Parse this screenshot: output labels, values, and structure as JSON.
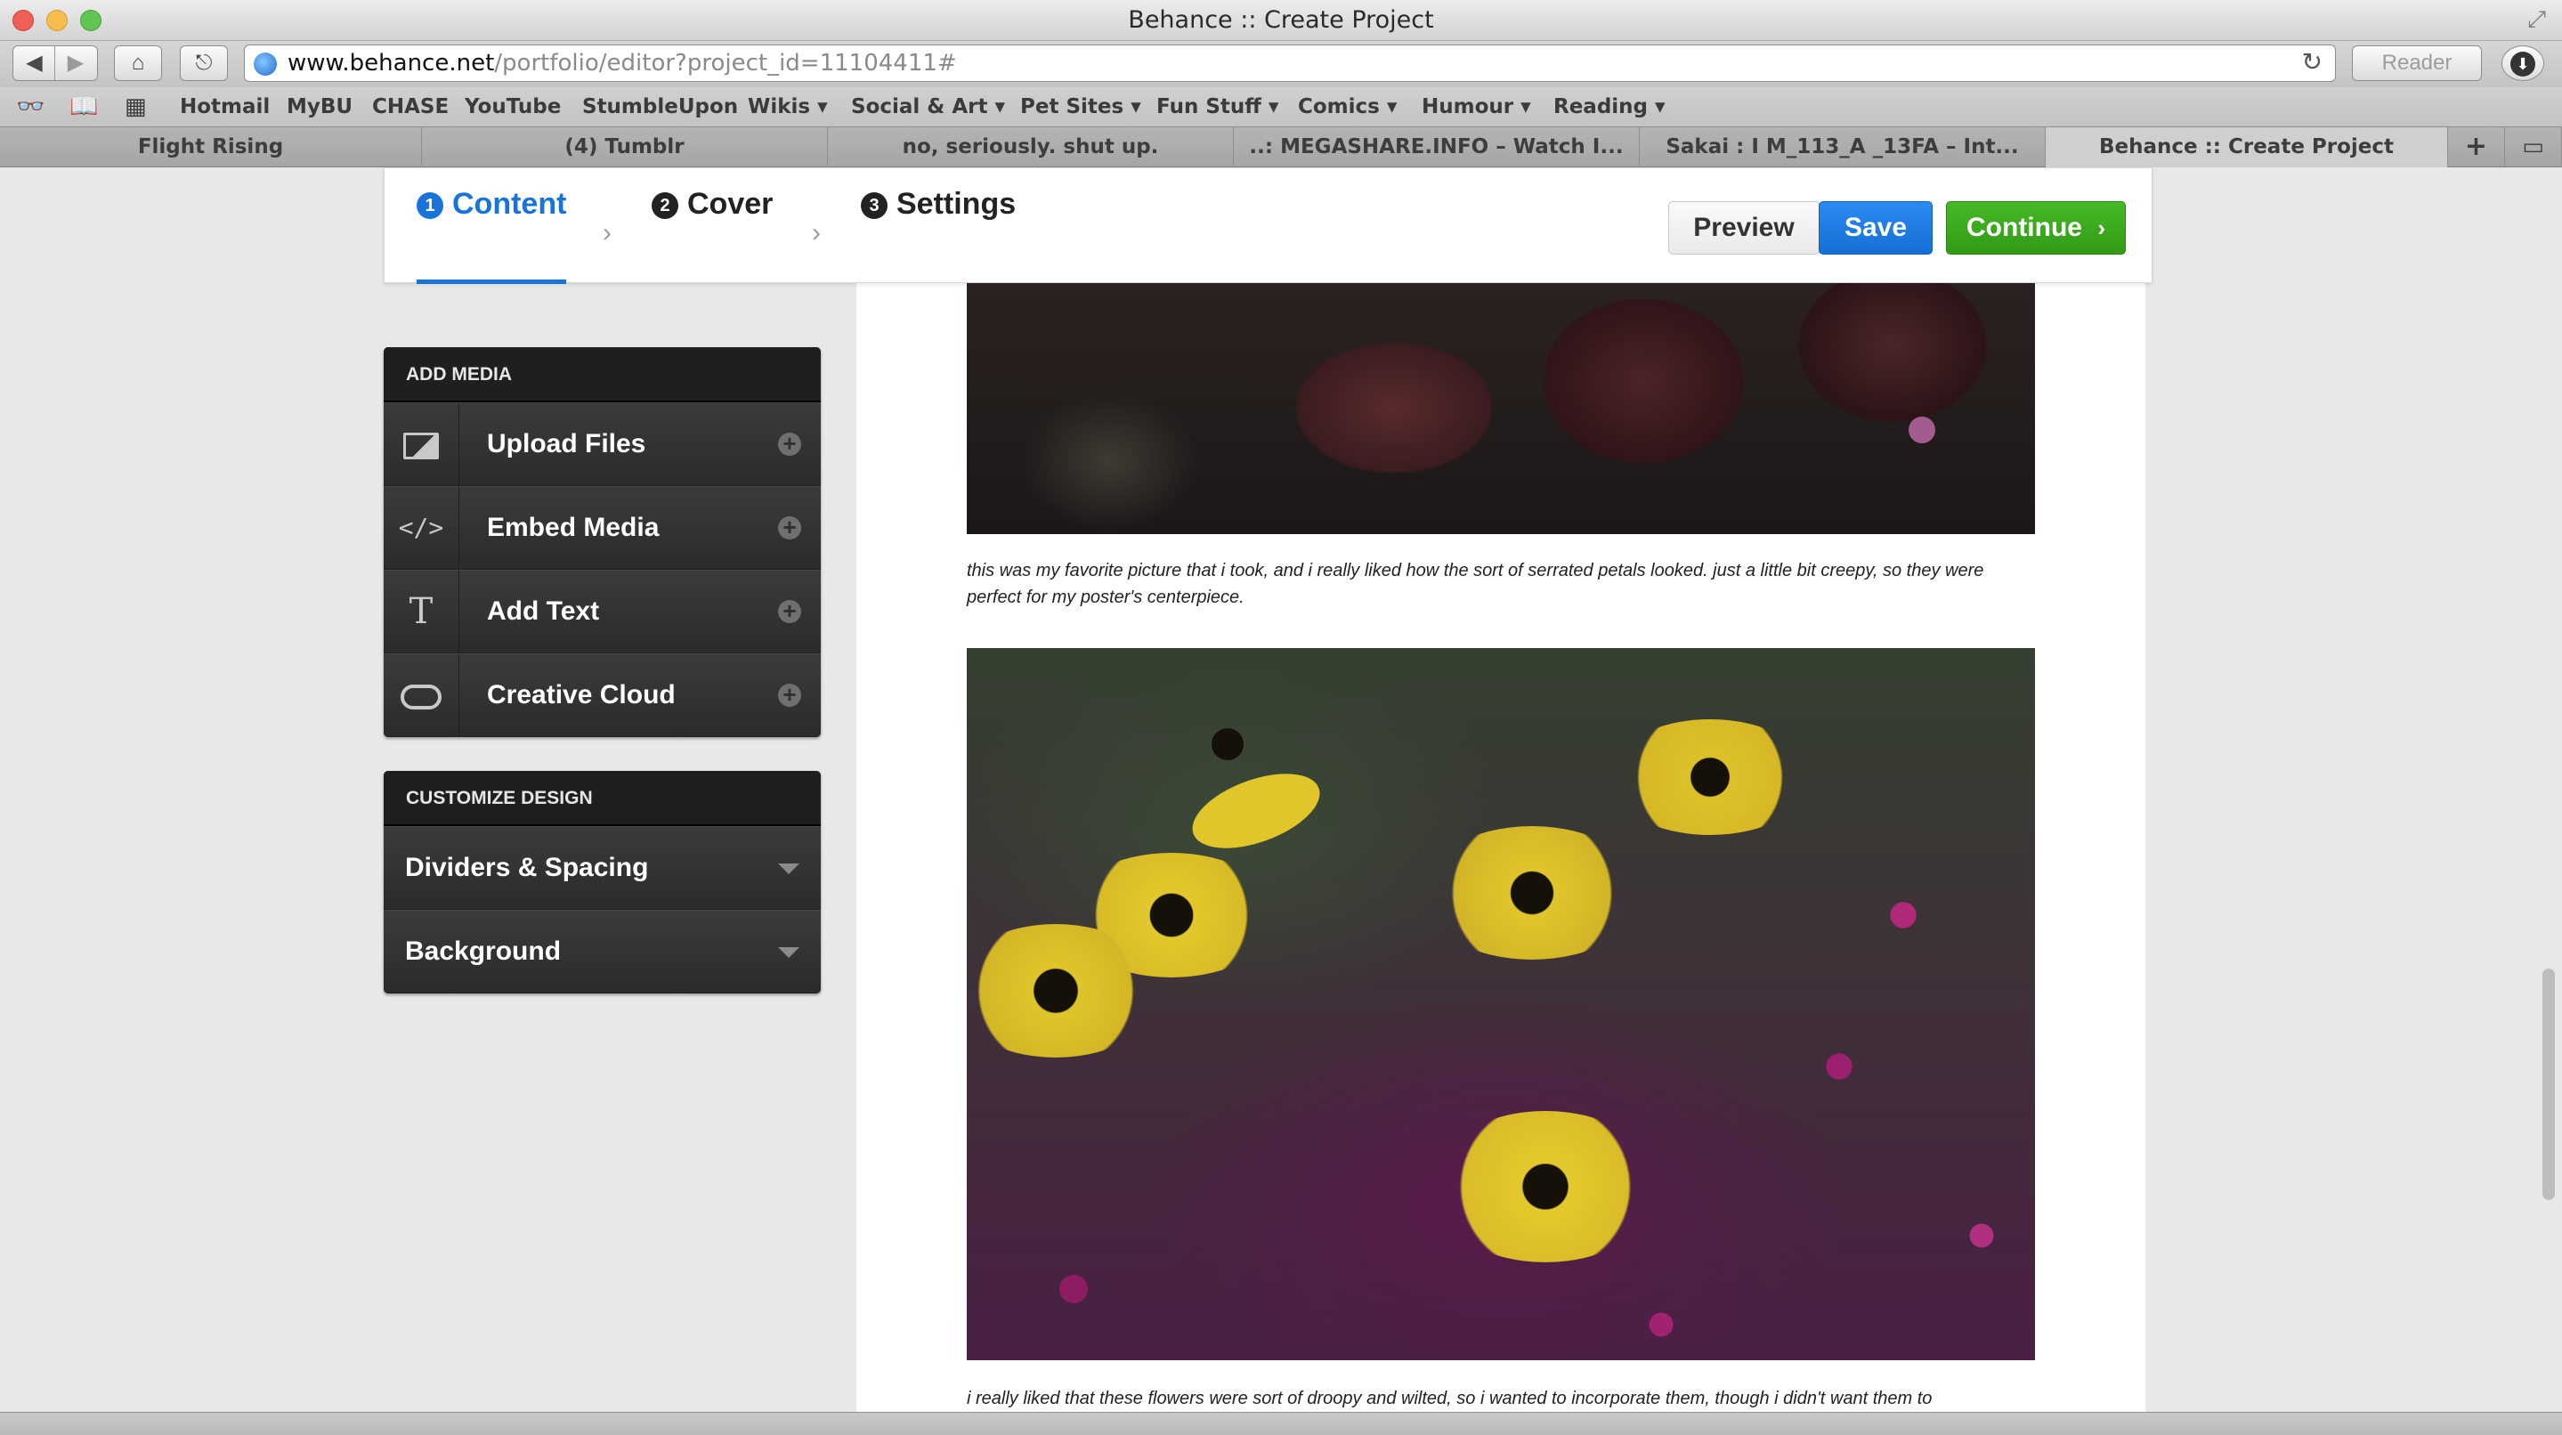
{
  "browser": {
    "window_title": "Behance :: Create Project",
    "url_domain": "www.behance.net",
    "url_path": "/portfolio/editor?project_id=11104411#",
    "reader_label": "Reader",
    "bookmarks": [
      "Hotmail",
      "MyBU",
      "CHASE",
      "YouTube",
      "StumbleUpon",
      "Wikis ▾",
      "Social & Art ▾",
      "Pet Sites ▾",
      "Fun Stuff ▾",
      "Comics ▾",
      "Humour ▾",
      "Reading ▾"
    ],
    "tabs": [
      "Flight Rising",
      "(4) Tumblr",
      "no, seriously. shut up.",
      "..: MEGASHARE.INFO – Watch I...",
      "Sakai : I M_113_A _13FA – Int...",
      "Behance :: Create Project"
    ],
    "active_tab_index": 5
  },
  "editor": {
    "steps": [
      {
        "num": "1",
        "label": "Content"
      },
      {
        "num": "2",
        "label": "Cover"
      },
      {
        "num": "3",
        "label": "Settings"
      }
    ],
    "active_step": "Content",
    "buttons": {
      "preview": "Preview",
      "save": "Save",
      "continue": "Continue"
    },
    "add_media": {
      "title": "ADD MEDIA",
      "items": [
        {
          "label": "Upload Files",
          "icon": "image-icon"
        },
        {
          "label": "Embed Media",
          "icon": "code-icon"
        },
        {
          "label": "Add Text",
          "icon": "text-icon"
        },
        {
          "label": "Creative Cloud",
          "icon": "creative-cloud-icon"
        }
      ]
    },
    "customize": {
      "title": "CUSTOMIZE DESIGN",
      "items": [
        "Dividers & Spacing",
        "Background"
      ]
    }
  },
  "project": {
    "caption_1": "this was my favorite picture that i took, and i really liked how the sort of serrated petals looked. just a little bit creepy, so they were perfect for my poster's centerpiece.",
    "caption_2": "i really liked that these flowers were sort of droopy and wilted, so i wanted to incorporate them, though i didn't want them to"
  },
  "colors": {
    "accent_blue": "#1a73d9",
    "save_blue": "#1e7ee8",
    "continue_green": "#3dab1f",
    "panel_dark": "#333333"
  }
}
